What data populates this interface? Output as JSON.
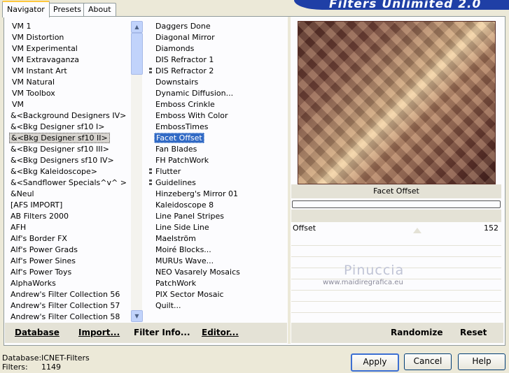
{
  "tabs": [
    "Navigator",
    "Presets",
    "About"
  ],
  "banner_title": "Filters Unlimited 2.0",
  "categories": [
    "VM 1",
    "VM Distortion",
    "VM Experimental",
    "VM Extravaganza",
    "VM Instant Art",
    "VM Natural",
    "VM Toolbox",
    "VM",
    "&<Background Designers IV>",
    "&<Bkg Designer sf10 I>",
    "&<Bkg Designer sf10 II>",
    "&<Bkg Designer sf10 III>",
    "&<Bkg Designers sf10 IV>",
    "&<Bkg Kaleidoscope>",
    "&<Sandflower Specials^v^ >",
    "&Neul",
    "[AFS IMPORT]",
    "AB Filters 2000",
    "AFH",
    "Alf's Border FX",
    "Alf's Power Grads",
    "Alf's Power Sines",
    "Alf's Power Toys",
    "AlphaWorks",
    "Andrew's Filter Collection 56",
    "Andrew's Filter Collection 57",
    "Andrew's Filter Collection 58"
  ],
  "selected_category": "&<Bkg Designer sf10 II>",
  "filters": [
    "Daggers Done",
    "Diagonal Mirror",
    "Diamonds",
    "DIS Refractor 1",
    "DIS Refractor 2",
    "Downstairs",
    "Dynamic Diffusion...",
    "Emboss Crinkle",
    "Emboss With Color",
    "EmbossTimes",
    "Facet Offset",
    "Fan Blades",
    "FH PatchWork",
    "Flutter",
    "Guidelines",
    "Hinzeberg's Mirror 01",
    "Kaleidoscope 8",
    "Line Panel Stripes",
    "Line Side Line",
    "Maelström",
    "Moiré Blocks...",
    "MURUs Wave...",
    "NEO Vasarely Mosaics",
    "PatchWork",
    "PIX Sector Mosaic",
    "Quilt..."
  ],
  "selected_filter": "Facet Offset",
  "filter_name_display": "Facet Offset",
  "param": {
    "label": "Offset",
    "value": "152"
  },
  "watermark": {
    "name": "Pinuccia",
    "site": "www.maidiregrafica.eu"
  },
  "left_buttons": {
    "database": "Database",
    "import": "Import...",
    "filter_info": "Filter Info...",
    "editor": "Editor..."
  },
  "right_buttons": {
    "randomize": "Randomize",
    "reset": "Reset"
  },
  "status": {
    "database_label": "Database:",
    "database_value": "ICNET-Filters",
    "filters_label": "Filters:",
    "filters_value": "1149"
  },
  "dialog_buttons": {
    "apply": "Apply",
    "cancel": "Cancel",
    "help": "Help"
  }
}
